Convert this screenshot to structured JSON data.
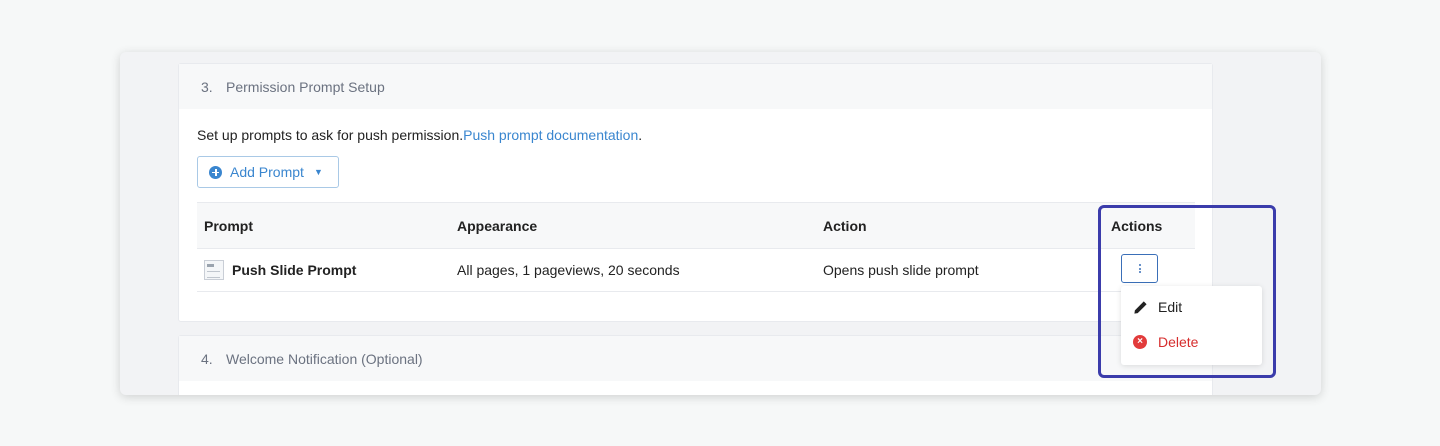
{
  "section3": {
    "number": "3.",
    "title": "Permission Prompt Setup",
    "description": "Set up prompts to ask for push permission.",
    "doc_link": "Push prompt documentation",
    "doc_link_suffix": ".",
    "add_button": {
      "label": "Add Prompt",
      "icon": "plus-circle-icon",
      "caret": "▼"
    },
    "table": {
      "columns": [
        "Prompt",
        "Appearance",
        "Action",
        "Actions"
      ],
      "rows": [
        {
          "prompt": "Push Slide Prompt",
          "appearance": "All pages, 1 pageviews, 20 seconds",
          "action": "Opens push slide prompt"
        }
      ]
    },
    "actions_menu": {
      "items": [
        {
          "label": "Edit",
          "icon": "pencil-icon"
        },
        {
          "label": "Delete",
          "icon": "x-circle-icon",
          "color": "#d62d2d"
        }
      ]
    }
  },
  "section4": {
    "number": "4.",
    "title": "Welcome Notification (Optional)"
  },
  "colors": {
    "link": "#3a86cf",
    "highlight_border": "#3b3cab",
    "danger": "#d62d2d"
  }
}
